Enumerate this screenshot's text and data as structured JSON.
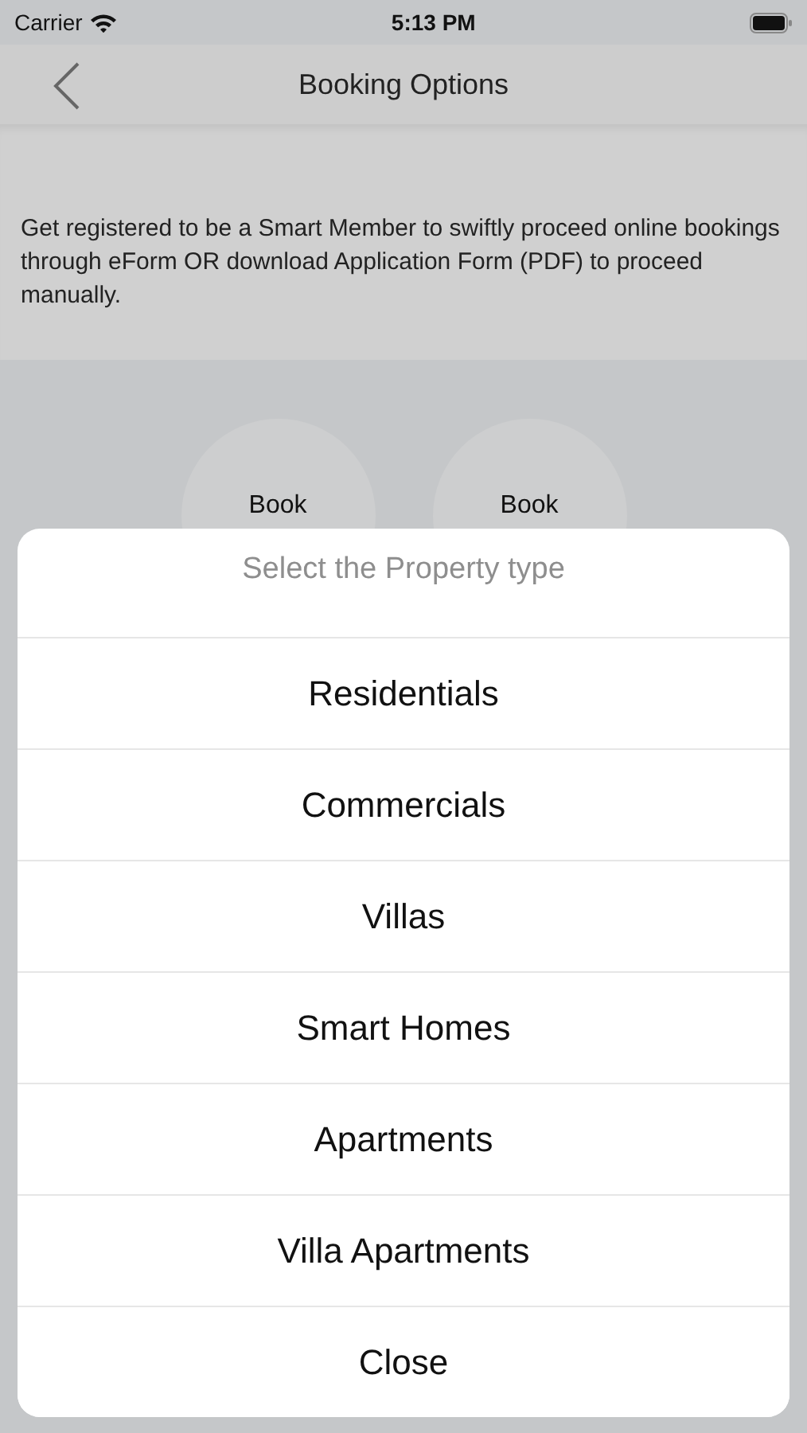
{
  "status_bar": {
    "carrier": "Carrier",
    "time": "5:13 PM"
  },
  "nav": {
    "title": "Booking Options"
  },
  "intro": "Get registered to be a Smart Member to swiftly proceed online bookings through eForm OR download Application Form (PDF) to proceed manually.",
  "options": [
    {
      "label": "Book"
    },
    {
      "label": "Book"
    }
  ],
  "sheet": {
    "title": "Select the Property type",
    "items": [
      {
        "label": "Residentials"
      },
      {
        "label": "Commercials"
      },
      {
        "label": "Villas"
      },
      {
        "label": "Smart Homes"
      },
      {
        "label": "Apartments"
      },
      {
        "label": "Villa Apartments"
      }
    ],
    "cancel": "Close"
  }
}
